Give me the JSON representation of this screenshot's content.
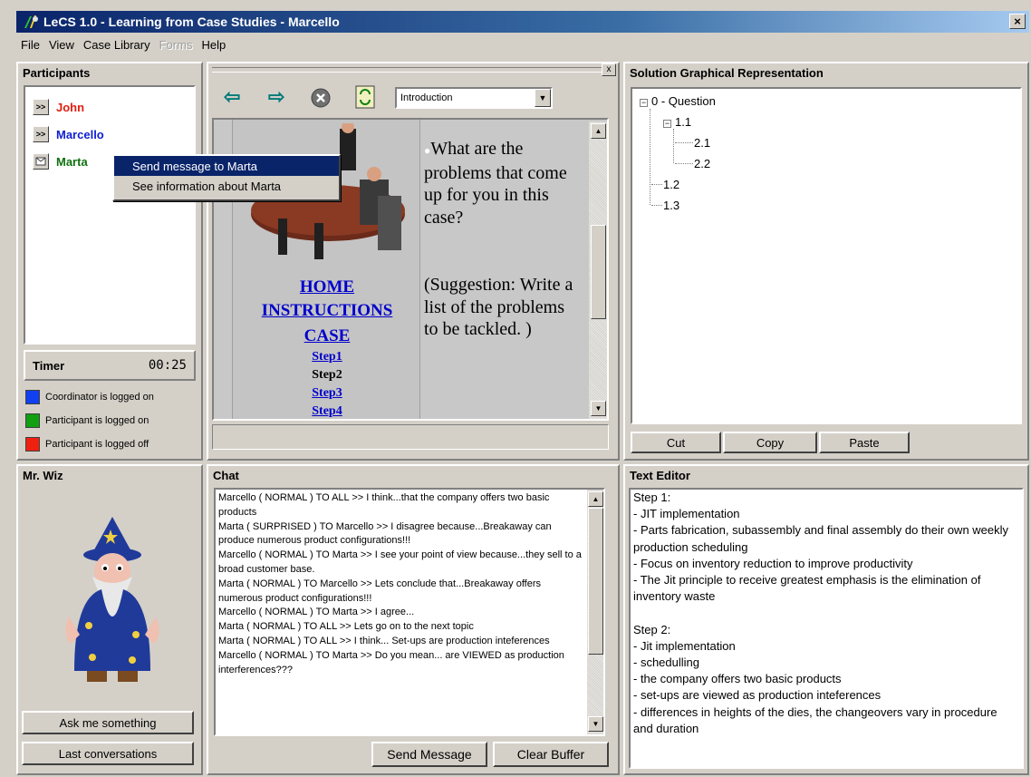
{
  "window": {
    "title": "LeCS 1.0 - Learning from Case Studies - Marcello",
    "close_label": "×"
  },
  "menu": [
    {
      "label": "File",
      "enabled": true
    },
    {
      "label": "View",
      "enabled": true
    },
    {
      "label": "Case Library",
      "enabled": true
    },
    {
      "label": "Forms",
      "enabled": false
    },
    {
      "label": "Help",
      "enabled": true
    }
  ],
  "participants": {
    "title": "Participants",
    "items": [
      {
        "name": "John",
        "button": ">>",
        "color": "#e02010"
      },
      {
        "name": "Marcello",
        "button": ">>",
        "color": "#1020d0"
      },
      {
        "name": "Marta",
        "button": "",
        "color": "#107010"
      }
    ],
    "timer_label": "Timer",
    "timer_value": "00:25",
    "legend": [
      {
        "label": "Coordinator is logged on",
        "color": "#1040f0"
      },
      {
        "label": "Participant is logged on",
        "color": "#10a010"
      },
      {
        "label": "Participant is logged off",
        "color": "#f02010"
      }
    ]
  },
  "context_menu": {
    "items": [
      "Send message to Marta",
      "See information about Marta"
    ]
  },
  "browser": {
    "close_label": "x",
    "page_select": "Introduction",
    "links": [
      "HOME",
      "INSTRUCTIONS",
      "CASE"
    ],
    "steps": [
      "Step1",
      "Step2",
      "Step3",
      "Step4"
    ],
    "question": "What are the problems that come up for you in this case?",
    "suggestion": "(Suggestion: Write a list of the problems to be tackled. )"
  },
  "solution": {
    "title": "Solution Graphical Representation",
    "tree": [
      "0 - Question",
      "1.1",
      "2.1",
      "2.2",
      "1.2",
      "1.3"
    ],
    "tree_toggle": "−",
    "buttons": [
      "Cut",
      "Copy",
      "Paste"
    ]
  },
  "wizard": {
    "title": "Mr. Wiz",
    "buttons": [
      "Ask me something",
      "Last conversations"
    ]
  },
  "chat": {
    "title": "Chat",
    "lines": [
      "Marcello ( NORMAL ) TO ALL >> I think...that the company offers two basic products",
      "Marta ( SURPRISED ) TO Marcello >> I disagree because...Breakaway can produce numerous product configurations!!!",
      "Marcello ( NORMAL ) TO Marta >> I see your point of view because...they sell to a broad customer base.",
      "Marta ( NORMAL ) TO Marcello >> Lets conclude that...Breakaway offers numerous product configurations!!!",
      "Marcello ( NORMAL ) TO Marta >> I agree...",
      "Marta ( NORMAL ) TO ALL >> Lets go on to the next topic",
      "Marta ( NORMAL ) TO ALL >> I think... Set-ups are production inteferences",
      "Marcello ( NORMAL ) TO Marta >> Do you mean... are VIEWED as production interferences???"
    ],
    "buttons": [
      "Send Message",
      "Clear Buffer"
    ]
  },
  "editor": {
    "title": "Text Editor",
    "lines": [
      "Step 1:",
      "- JIT implementation",
      "- Parts fabrication, subassembly and final assembly do their own weekly production scheduling",
      "- Focus on inventory reduction to improve productivity",
      "- The Jit principle to receive greatest emphasis is the elimination of inventory waste",
      "",
      "Step 2:",
      "- Jit implementation",
      "- schedulling",
      "- the company offers two basic products",
      "- set-ups are viewed as production inteferences",
      "- differences in heights of the dies, the changeovers vary in procedure and duration"
    ]
  }
}
